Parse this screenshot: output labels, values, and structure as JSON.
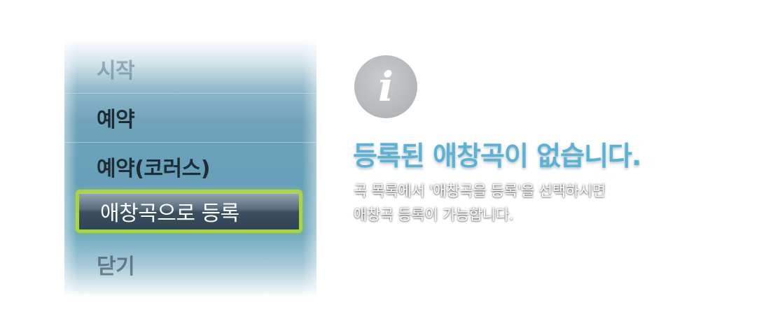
{
  "menu": {
    "items": [
      {
        "label": "시작"
      },
      {
        "label": "예약"
      },
      {
        "label": "예약(코러스)"
      },
      {
        "label": "애창곡으로 등록"
      },
      {
        "label": "닫기"
      }
    ],
    "selected_index": 3
  },
  "info": {
    "icon": "info-icon",
    "icon_glyph": "i",
    "title": "등록된 애창곡이 없습니다.",
    "description_line1": "곡 목록에서 '애창곡을 등록'을 선택하시면",
    "description_line2": "애창곡 등록이 가능합니다."
  },
  "colors": {
    "highlight_border": "#a9d63b",
    "title_text": "#58b4d6",
    "panel_blue": "#65a0b8"
  }
}
